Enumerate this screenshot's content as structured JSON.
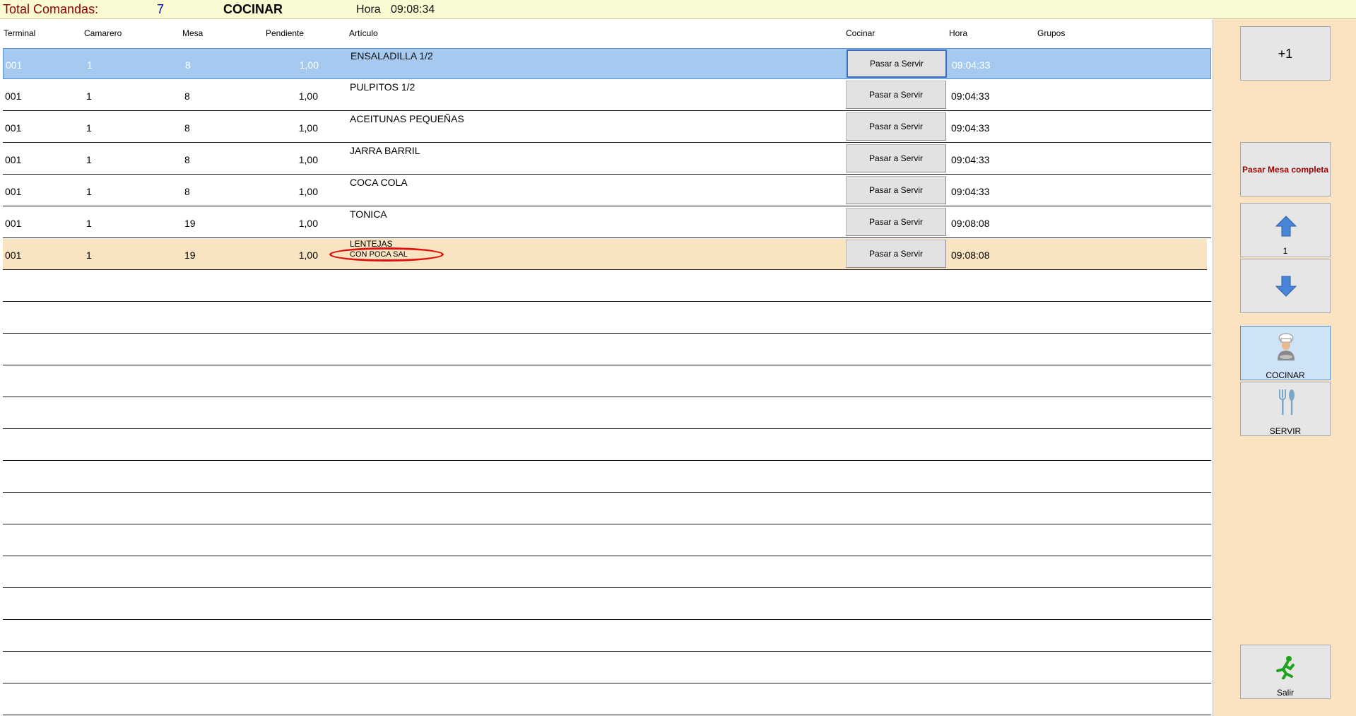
{
  "header": {
    "total_label": "Total Comandas:",
    "total_value": "7",
    "mode": "COCINAR",
    "hora_label": "Hora",
    "hora_value": "09:08:34"
  },
  "columns": {
    "terminal": "Terminal",
    "camarero": "Camarero",
    "mesa": "Mesa",
    "pendiente": "Pendiente",
    "articulo": "Artículo",
    "cocinar": "Cocinar",
    "hora": "Hora",
    "grupos": "Grupos"
  },
  "rows": [
    {
      "terminal": "001",
      "camarero": "1",
      "mesa": "8",
      "pendiente": "1,00",
      "articulo": "ENSALADILLA 1/2",
      "note": "",
      "button": "Pasar a Servir",
      "hora": "09:04:33"
    },
    {
      "terminal": "001",
      "camarero": "1",
      "mesa": "8",
      "pendiente": "1,00",
      "articulo": "PULPITOS 1/2",
      "note": "",
      "button": "Pasar a Servir",
      "hora": "09:04:33"
    },
    {
      "terminal": "001",
      "camarero": "1",
      "mesa": "8",
      "pendiente": "1,00",
      "articulo": "ACEITUNAS PEQUEÑAS",
      "note": "",
      "button": "Pasar a Servir",
      "hora": "09:04:33"
    },
    {
      "terminal": "001",
      "camarero": "1",
      "mesa": "8",
      "pendiente": "1,00",
      "articulo": "JARRA BARRIL",
      "note": "",
      "button": "Pasar a Servir",
      "hora": "09:04:33"
    },
    {
      "terminal": "001",
      "camarero": "1",
      "mesa": "8",
      "pendiente": "1,00",
      "articulo": "COCA COLA",
      "note": "",
      "button": "Pasar a Servir",
      "hora": "09:04:33"
    },
    {
      "terminal": "001",
      "camarero": "1",
      "mesa": "19",
      "pendiente": "1,00",
      "articulo": "TONICA",
      "note": "",
      "button": "Pasar a Servir",
      "hora": "09:08:08"
    },
    {
      "terminal": "001",
      "camarero": "1",
      "mesa": "19",
      "pendiente": "1,00",
      "articulo": "LENTEJAS",
      "note": "CON POCA SAL",
      "button": "Pasar a Servir",
      "hora": "09:08:08"
    }
  ],
  "side": {
    "plus_one": "+1",
    "pasar_mesa": "Pasar Mesa completa",
    "page_number": "1",
    "cocinar": "COCINAR",
    "servir": "SERVIR",
    "salir": "Salir"
  },
  "icons": [
    "arrow-up-icon",
    "arrow-down-icon",
    "chef-icon",
    "fork-knife-icon",
    "running-man-icon"
  ],
  "colors": {
    "header_bg": "#fafad2",
    "selected_row": "#a5c9ef",
    "highlight_row": "#f9e4c2",
    "side_panel": "#fbe2c0",
    "note_ring": "#e01010"
  }
}
